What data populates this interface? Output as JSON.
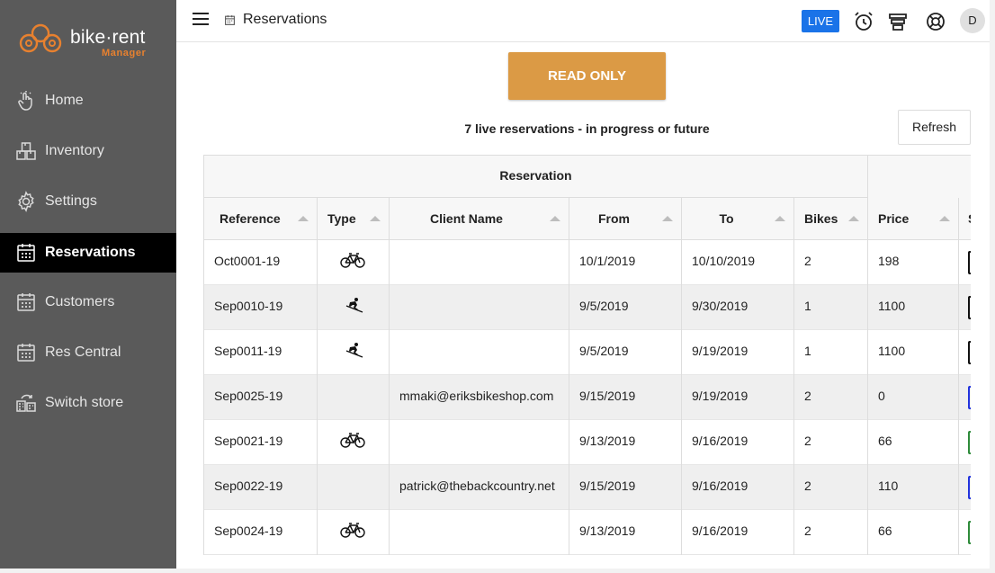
{
  "app": {
    "logo_text": "bike·rent",
    "logo_sub": "Manager"
  },
  "sidebar": {
    "items": [
      {
        "label": "Home",
        "icon": "hand-pointer-icon",
        "active": false
      },
      {
        "label": "Inventory",
        "icon": "boxes-icon",
        "active": false
      },
      {
        "label": "Settings",
        "icon": "gear-icon",
        "active": false
      },
      {
        "label": "Reservations",
        "icon": "calendar-icon",
        "active": true
      },
      {
        "label": "Customers",
        "icon": "calendar-icon",
        "active": false
      },
      {
        "label": "Res Central",
        "icon": "calendar-icon",
        "active": false
      },
      {
        "label": "Switch store",
        "icon": "switch-store-icon",
        "active": false
      }
    ]
  },
  "header": {
    "title": "Reservations",
    "live_label": "LIVE",
    "avatar_initial": "D",
    "icons": [
      "alarm-clock-icon",
      "stack-icon",
      "lifebuoy-icon"
    ]
  },
  "main": {
    "read_only_label": "READ ONLY",
    "count_text": "7 live reservations - in progress or future",
    "refresh_label": "Refresh"
  },
  "table": {
    "group_header": "Reservation",
    "columns": [
      "Reference",
      "Type",
      "Client Name",
      "From",
      "To",
      "Bikes",
      "Price",
      "S"
    ],
    "rows": [
      {
        "reference": "Oct0001-19",
        "type": "bicycle-icon",
        "client": "",
        "from": "10/1/2019",
        "to": "10/10/2019",
        "bikes": "2",
        "price": "198",
        "status_color": "#111111"
      },
      {
        "reference": "Sep0010-19",
        "type": "skier-icon",
        "client": "",
        "from": "9/5/2019",
        "to": "9/30/2019",
        "bikes": "1",
        "price": "1100",
        "status_color": "#111111"
      },
      {
        "reference": "Sep0011-19",
        "type": "skier-icon",
        "client": "",
        "from": "9/5/2019",
        "to": "9/19/2019",
        "bikes": "1",
        "price": "1100",
        "status_color": "#111111"
      },
      {
        "reference": "Sep0025-19",
        "type": "",
        "client": "mmaki@eriksbikeshop.com",
        "from": "9/15/2019",
        "to": "9/19/2019",
        "bikes": "2",
        "price": "0",
        "status_color": "#2233dd"
      },
      {
        "reference": "Sep0021-19",
        "type": "bicycle-icon",
        "client": "",
        "from": "9/13/2019",
        "to": "9/16/2019",
        "bikes": "2",
        "price": "66",
        "status_color": "#2e8b3a"
      },
      {
        "reference": "Sep0022-19",
        "type": "",
        "client": "patrick@thebackcountry.net",
        "from": "9/15/2019",
        "to": "9/16/2019",
        "bikes": "2",
        "price": "110",
        "status_color": "#2233dd"
      },
      {
        "reference": "Sep0024-19",
        "type": "bicycle-icon",
        "client": "",
        "from": "9/13/2019",
        "to": "9/16/2019",
        "bikes": "2",
        "price": "66",
        "status_color": "#2e8b3a"
      }
    ]
  },
  "colors": {
    "sidebar_bg": "#5a5a5a",
    "active_bg": "#000000",
    "accent_orange": "#db9a45",
    "live_blue": "#1a73e8",
    "logo_orange": "#e8812f"
  }
}
